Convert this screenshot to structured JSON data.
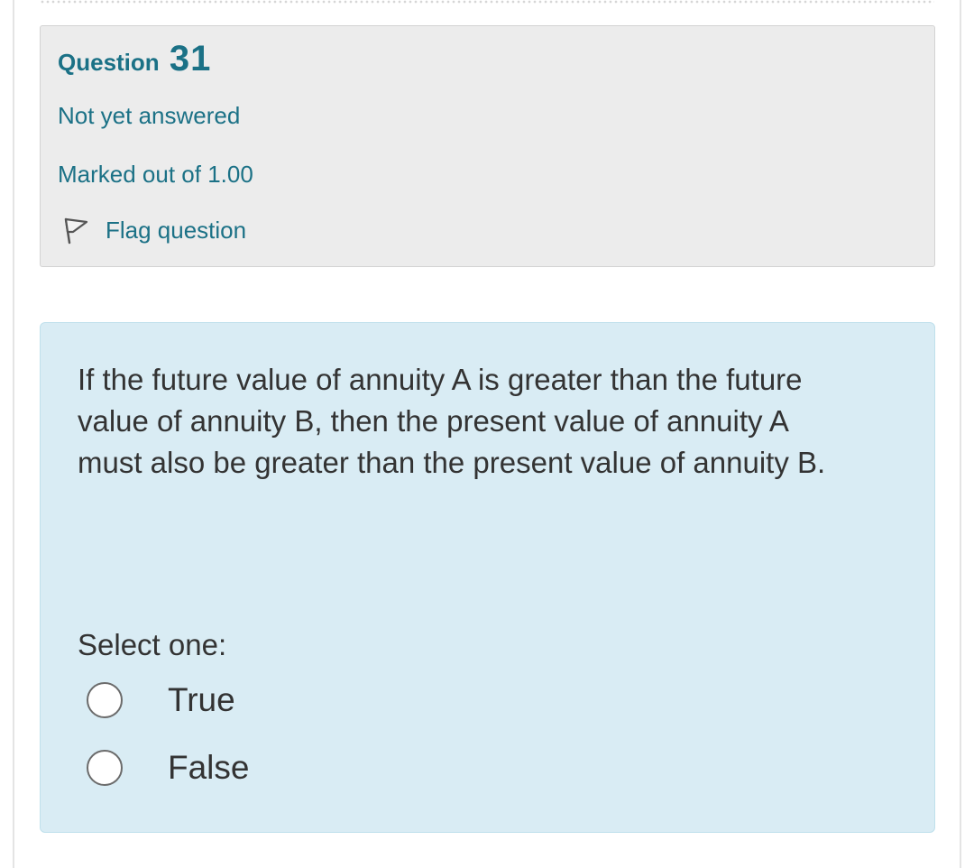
{
  "question_info": {
    "question_word": "Question",
    "question_number": "31",
    "state": "Not yet answered",
    "grade": "Marked out of 1.00",
    "flag_label": "Flag question",
    "flag_icon": "flag-icon"
  },
  "question": {
    "text": "If the future value of annuity A is greater than the future value of annuity B, then the present value of annuity A must also be greater than the present value of annuity B.",
    "prompt": "Select one:",
    "options": [
      {
        "label": "True",
        "selected": false
      },
      {
        "label": "False",
        "selected": false
      }
    ]
  },
  "colors": {
    "accent": "#1b7186",
    "info_background": "#ececec",
    "content_background": "#d9ecf4",
    "text": "#333333"
  }
}
